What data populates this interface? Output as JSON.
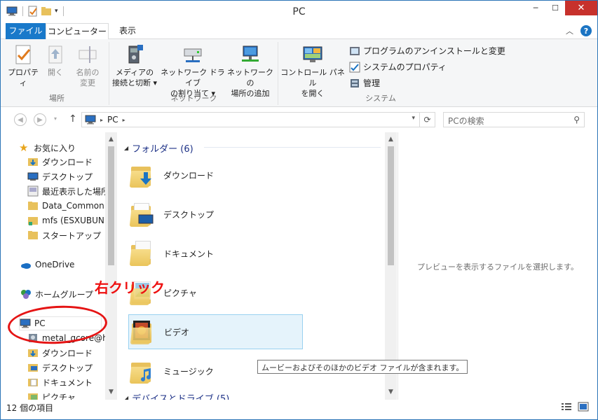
{
  "window": {
    "title": "PC"
  },
  "titlebar": {
    "minimize": "─",
    "maximize": "☐",
    "close": "✕"
  },
  "tabs": {
    "file": "ファイル",
    "computer": "コンピューター",
    "view": "表示"
  },
  "ribbon": {
    "location": {
      "label": "場所",
      "properties": "プロパティ",
      "open": "開く",
      "rename_1": "名前の",
      "rename_2": "変更"
    },
    "network": {
      "label": "ネットワーク",
      "media_1": "メディアの",
      "media_2": "接続と切断 ▾",
      "map_drive_1": "ネットワーク ドライブ",
      "map_drive_2": "の割り当て ▾",
      "add_location_1": "ネットワークの",
      "add_location_2": "場所の追加"
    },
    "system": {
      "label": "システム",
      "control_panel_1": "コントロール パネル",
      "control_panel_2": "を開く",
      "uninstall": "プログラムのアンインストールと変更",
      "system_properties": "システムのプロパティ",
      "manage": "管理"
    }
  },
  "address": {
    "path": "PC",
    "sep": "▸"
  },
  "search": {
    "placeholder": "PCの検索"
  },
  "navpane": {
    "favorites": "お気に入り",
    "fav_items": [
      "ダウンロード",
      "デスクトップ",
      "最近表示した場所",
      "Data_Common",
      "mfs (ESXUBUN",
      "スタートアップ"
    ],
    "onedrive": "OneDrive",
    "homegroup": "ホームグループ",
    "pc": "PC",
    "pc_items": [
      "metal_gcore@h",
      "ダウンロード",
      "デスクトップ",
      "ドキュメント",
      "ピクチャ"
    ]
  },
  "content": {
    "group_header": "フォルダー (6)",
    "folders": [
      "ダウンロード",
      "デスクトップ",
      "ドキュメント",
      "ピクチャ",
      "ビデオ",
      "ミュージック"
    ],
    "next_group": "デバイスとドライブ (5)"
  },
  "preview": {
    "message": "プレビューを表示するファイルを選択します。"
  },
  "tooltip": {
    "text": "ムービーおよびそのほかのビデオ ファイルが含まれます。"
  },
  "status": {
    "count": "12 個の項目"
  },
  "annotation": {
    "text": "右クリック",
    "color": "#ee1111"
  },
  "colors": {
    "accent": "#1979ca",
    "folder": "#eac45a",
    "selection": "#e5f3fb"
  }
}
